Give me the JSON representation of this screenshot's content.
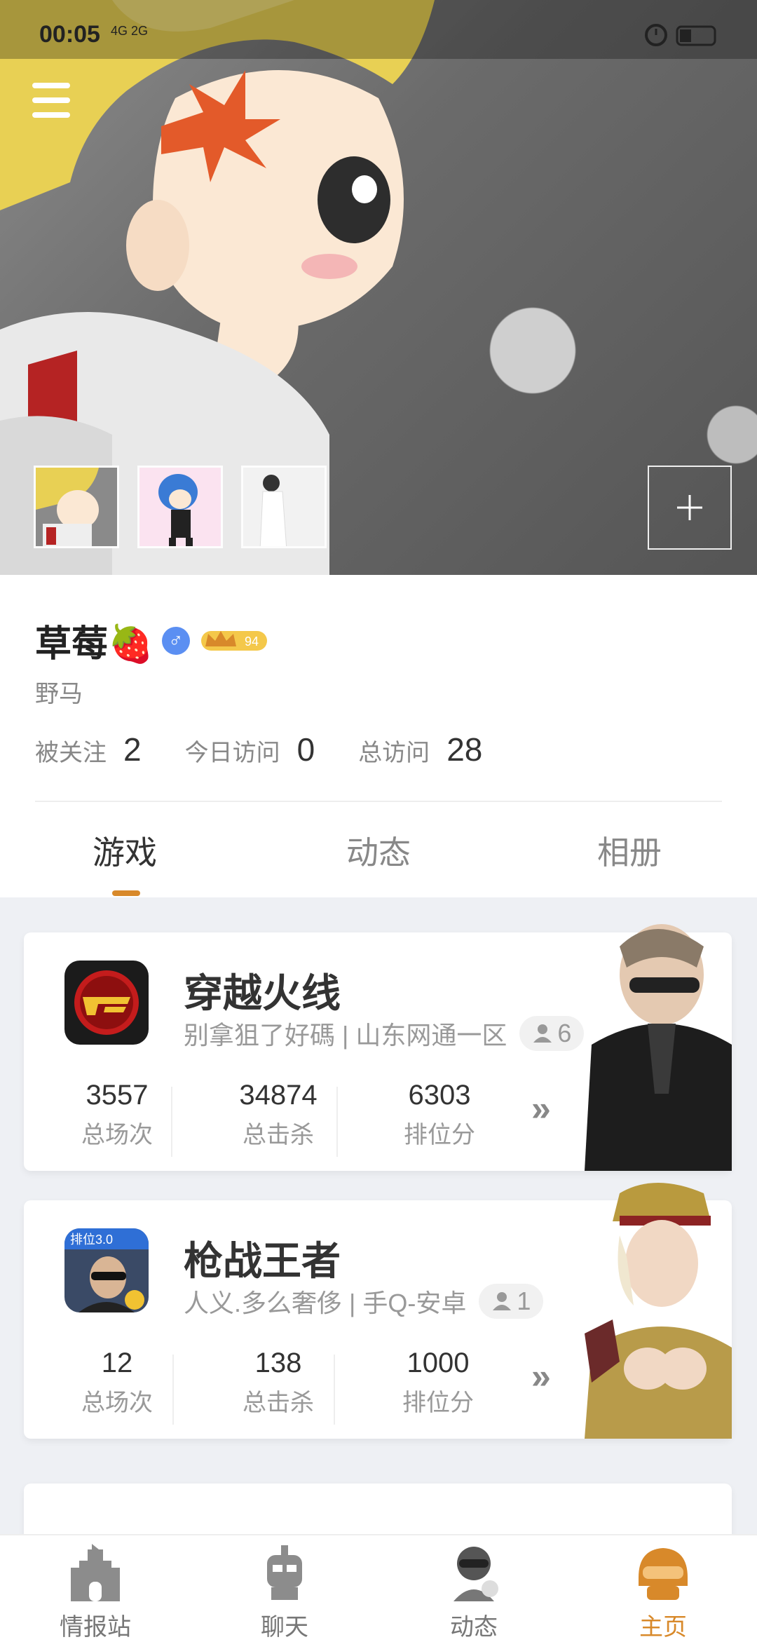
{
  "status_bar": {
    "time": "00:05",
    "network": "4G 2G"
  },
  "profile": {
    "name": "草莓🍓",
    "gender_symbol": "♂",
    "vip_level": "94",
    "signature": "野马",
    "stats": [
      {
        "label": "被关注",
        "value": "2"
      },
      {
        "label": "今日访问",
        "value": "0"
      },
      {
        "label": "总访问",
        "value": "28"
      }
    ]
  },
  "tabs": [
    {
      "label": "游戏",
      "active": true
    },
    {
      "label": "动态",
      "active": false
    },
    {
      "label": "相册",
      "active": false
    }
  ],
  "games": [
    {
      "title": "穿越火线",
      "subtitle": "别拿狙了好碼 | 山东网通一区",
      "friends": "6",
      "stats": [
        {
          "value": "3557",
          "label": "总场次"
        },
        {
          "value": "34874",
          "label": "总击杀"
        },
        {
          "value": "6303",
          "label": "排位分"
        }
      ]
    },
    {
      "title": "枪战王者",
      "subtitle": "人义.多么奢侈 | 手Q-安卓",
      "friends": "1",
      "stats": [
        {
          "value": "12",
          "label": "总场次"
        },
        {
          "value": "138",
          "label": "总击杀"
        },
        {
          "value": "1000",
          "label": "排位分"
        }
      ]
    }
  ],
  "bottom_nav": [
    {
      "label": "情报站",
      "icon": "castle-icon",
      "active": false
    },
    {
      "label": "聊天",
      "icon": "robot-icon",
      "active": false
    },
    {
      "label": "动态",
      "icon": "soldier-icon",
      "active": false
    },
    {
      "label": "主页",
      "icon": "helmet-icon",
      "active": true
    }
  ],
  "colors": {
    "accent": "#d8892a",
    "male_badge": "#5b8ff2"
  }
}
